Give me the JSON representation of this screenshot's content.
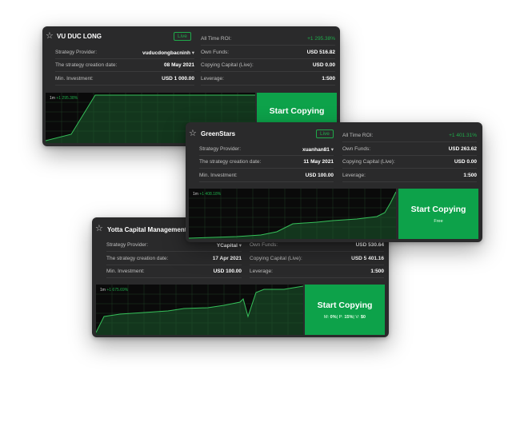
{
  "cards": [
    {
      "name": "VU DUC LONG",
      "badge": "Live",
      "left_rows": [
        {
          "label": "Strategy Provider:",
          "value": "vuducdongbacninh"
        },
        {
          "label": "The strategy creation date:",
          "value": "08 May 2021"
        },
        {
          "label": "Min. Investment:",
          "value": "USD 1 000.00"
        }
      ],
      "right_rows": [
        {
          "label": "All Time ROI:",
          "value": "+1 295.38%"
        },
        {
          "label": "Own Funds:",
          "value": "USD 516.82"
        },
        {
          "label": "Copying Capital (Live):",
          "value": "USD 0.00"
        },
        {
          "label": "Leverage:",
          "value": "1:500"
        }
      ],
      "chart_label_period": "1m",
      "chart_label_value": "+1 295.38%",
      "cta_title": "Start Copying"
    },
    {
      "name": "GreenStars",
      "badge": "Live",
      "left_rows": [
        {
          "label": "Strategy Provider:",
          "value": "xuanhan81"
        },
        {
          "label": "The strategy creation date:",
          "value": "11 May 2021"
        },
        {
          "label": "Min. Investment:",
          "value": "USD 100.00"
        }
      ],
      "right_rows": [
        {
          "label": "All Time ROI:",
          "value": "+1 401.31%"
        },
        {
          "label": "Own Funds:",
          "value": "USD 263.62"
        },
        {
          "label": "Copying Capital (Live):",
          "value": "USD 0.00"
        },
        {
          "label": "Leverage:",
          "value": "1:500"
        }
      ],
      "chart_label_period": "1m",
      "chart_label_value": "+1 408.18%",
      "cta_title": "Start Copying",
      "cta_sub": "Free"
    },
    {
      "name": "Yotta Capital Management",
      "left_rows": [
        {
          "label": "Strategy Provider:",
          "value": "YCapital"
        },
        {
          "label": "The strategy creation date:",
          "value": "17 Apr 2021"
        },
        {
          "label": "Min. Investment:",
          "value": "USD 100.00"
        }
      ],
      "right_rows": [
        {
          "label": "Own Funds:",
          "value": "USD 530.64"
        },
        {
          "label": "Copying Capital (Live):",
          "value": "USD 5 401.16"
        },
        {
          "label": "Leverage:",
          "value": "1:500"
        }
      ],
      "chart_label_period": "1m",
      "chart_label_value": "+1 675.69%",
      "cta_title": "Start Copying",
      "cta_sub": {
        "m_label": "M:",
        "m_value": "0%",
        "p_label": "P:",
        "p_value": "15%",
        "v_label": "V:",
        "v_value": "$0"
      }
    }
  ],
  "colors": {
    "accent": "#0da24a",
    "card_bg": "#2a2a2b",
    "chart_bg": "#0a0a0a",
    "roi_green": "#1faa4a"
  }
}
